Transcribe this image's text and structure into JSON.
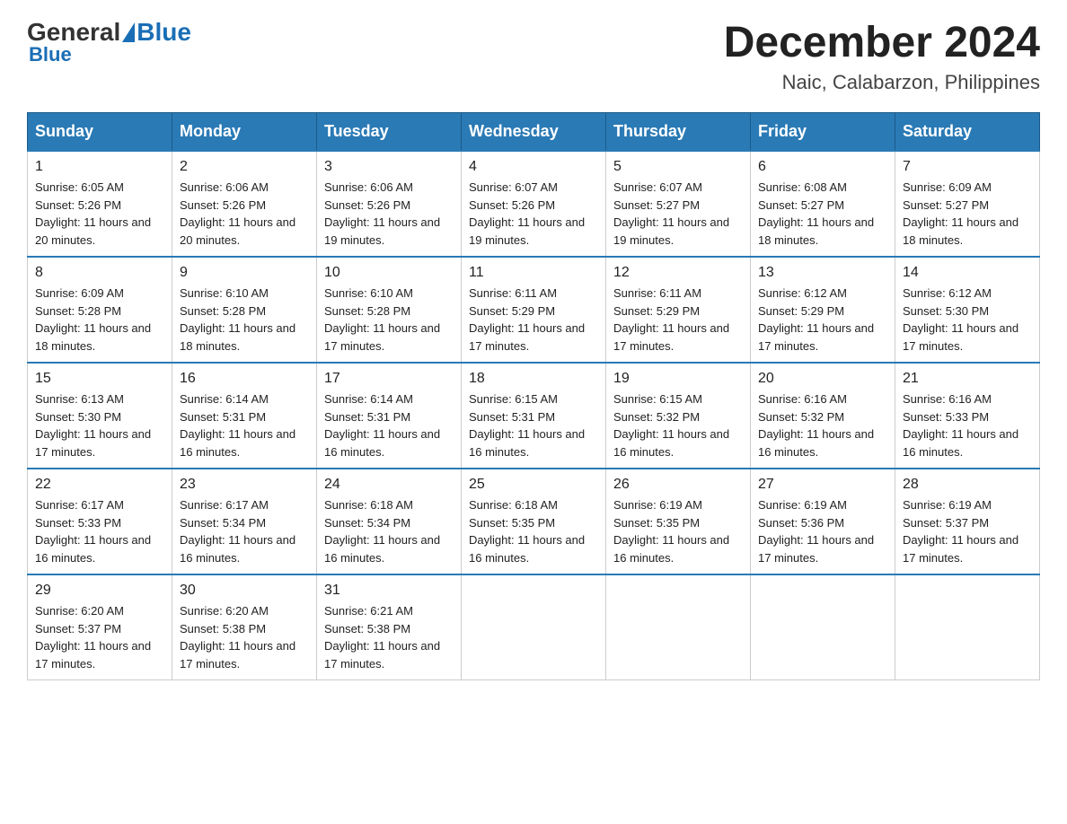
{
  "logo": {
    "general": "General",
    "blue": "Blue"
  },
  "title": "December 2024",
  "subtitle": "Naic, Calabarzon, Philippines",
  "days_of_week": [
    "Sunday",
    "Monday",
    "Tuesday",
    "Wednesday",
    "Thursday",
    "Friday",
    "Saturday"
  ],
  "weeks": [
    [
      {
        "day": "1",
        "sunrise": "6:05 AM",
        "sunset": "5:26 PM",
        "daylight": "11 hours and 20 minutes."
      },
      {
        "day": "2",
        "sunrise": "6:06 AM",
        "sunset": "5:26 PM",
        "daylight": "11 hours and 20 minutes."
      },
      {
        "day": "3",
        "sunrise": "6:06 AM",
        "sunset": "5:26 PM",
        "daylight": "11 hours and 19 minutes."
      },
      {
        "day": "4",
        "sunrise": "6:07 AM",
        "sunset": "5:26 PM",
        "daylight": "11 hours and 19 minutes."
      },
      {
        "day": "5",
        "sunrise": "6:07 AM",
        "sunset": "5:27 PM",
        "daylight": "11 hours and 19 minutes."
      },
      {
        "day": "6",
        "sunrise": "6:08 AM",
        "sunset": "5:27 PM",
        "daylight": "11 hours and 18 minutes."
      },
      {
        "day": "7",
        "sunrise": "6:09 AM",
        "sunset": "5:27 PM",
        "daylight": "11 hours and 18 minutes."
      }
    ],
    [
      {
        "day": "8",
        "sunrise": "6:09 AM",
        "sunset": "5:28 PM",
        "daylight": "11 hours and 18 minutes."
      },
      {
        "day": "9",
        "sunrise": "6:10 AM",
        "sunset": "5:28 PM",
        "daylight": "11 hours and 18 minutes."
      },
      {
        "day": "10",
        "sunrise": "6:10 AM",
        "sunset": "5:28 PM",
        "daylight": "11 hours and 17 minutes."
      },
      {
        "day": "11",
        "sunrise": "6:11 AM",
        "sunset": "5:29 PM",
        "daylight": "11 hours and 17 minutes."
      },
      {
        "day": "12",
        "sunrise": "6:11 AM",
        "sunset": "5:29 PM",
        "daylight": "11 hours and 17 minutes."
      },
      {
        "day": "13",
        "sunrise": "6:12 AM",
        "sunset": "5:29 PM",
        "daylight": "11 hours and 17 minutes."
      },
      {
        "day": "14",
        "sunrise": "6:12 AM",
        "sunset": "5:30 PM",
        "daylight": "11 hours and 17 minutes."
      }
    ],
    [
      {
        "day": "15",
        "sunrise": "6:13 AM",
        "sunset": "5:30 PM",
        "daylight": "11 hours and 17 minutes."
      },
      {
        "day": "16",
        "sunrise": "6:14 AM",
        "sunset": "5:31 PM",
        "daylight": "11 hours and 16 minutes."
      },
      {
        "day": "17",
        "sunrise": "6:14 AM",
        "sunset": "5:31 PM",
        "daylight": "11 hours and 16 minutes."
      },
      {
        "day": "18",
        "sunrise": "6:15 AM",
        "sunset": "5:31 PM",
        "daylight": "11 hours and 16 minutes."
      },
      {
        "day": "19",
        "sunrise": "6:15 AM",
        "sunset": "5:32 PM",
        "daylight": "11 hours and 16 minutes."
      },
      {
        "day": "20",
        "sunrise": "6:16 AM",
        "sunset": "5:32 PM",
        "daylight": "11 hours and 16 minutes."
      },
      {
        "day": "21",
        "sunrise": "6:16 AM",
        "sunset": "5:33 PM",
        "daylight": "11 hours and 16 minutes."
      }
    ],
    [
      {
        "day": "22",
        "sunrise": "6:17 AM",
        "sunset": "5:33 PM",
        "daylight": "11 hours and 16 minutes."
      },
      {
        "day": "23",
        "sunrise": "6:17 AM",
        "sunset": "5:34 PM",
        "daylight": "11 hours and 16 minutes."
      },
      {
        "day": "24",
        "sunrise": "6:18 AM",
        "sunset": "5:34 PM",
        "daylight": "11 hours and 16 minutes."
      },
      {
        "day": "25",
        "sunrise": "6:18 AM",
        "sunset": "5:35 PM",
        "daylight": "11 hours and 16 minutes."
      },
      {
        "day": "26",
        "sunrise": "6:19 AM",
        "sunset": "5:35 PM",
        "daylight": "11 hours and 16 minutes."
      },
      {
        "day": "27",
        "sunrise": "6:19 AM",
        "sunset": "5:36 PM",
        "daylight": "11 hours and 17 minutes."
      },
      {
        "day": "28",
        "sunrise": "6:19 AM",
        "sunset": "5:37 PM",
        "daylight": "11 hours and 17 minutes."
      }
    ],
    [
      {
        "day": "29",
        "sunrise": "6:20 AM",
        "sunset": "5:37 PM",
        "daylight": "11 hours and 17 minutes."
      },
      {
        "day": "30",
        "sunrise": "6:20 AM",
        "sunset": "5:38 PM",
        "daylight": "11 hours and 17 minutes."
      },
      {
        "day": "31",
        "sunrise": "6:21 AM",
        "sunset": "5:38 PM",
        "daylight": "11 hours and 17 minutes."
      },
      null,
      null,
      null,
      null
    ]
  ],
  "labels": {
    "sunrise": "Sunrise:",
    "sunset": "Sunset:",
    "daylight": "Daylight:"
  }
}
